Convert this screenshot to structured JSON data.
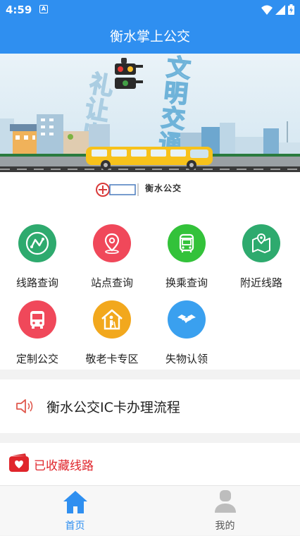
{
  "status_bar": {
    "time": "4:59",
    "notification_glyph": "A"
  },
  "app_bar": {
    "title": "衡水掌上公交"
  },
  "banner": {
    "slogan_left": "礼让出行",
    "slogan_right": "文明交通"
  },
  "logo": {
    "text": "衡水公交"
  },
  "menu": {
    "items": [
      {
        "label": "线路查询",
        "color": "#2eaa6e",
        "icon": "route-icon"
      },
      {
        "label": "站点查询",
        "color": "#f0485a",
        "icon": "location-pin-icon"
      },
      {
        "label": "换乘查询",
        "color": "#33c23a",
        "icon": "bus-front-icon"
      },
      {
        "label": "附近线路",
        "color": "#2eaa6e",
        "icon": "map-pin-icon"
      },
      {
        "label": "定制公交",
        "color": "#f0485a",
        "icon": "bus-icon"
      },
      {
        "label": "敬老卡专区",
        "color": "#f2a81d",
        "icon": "elderly-home-icon"
      },
      {
        "label": "失物认领",
        "color": "#3aa0ef",
        "icon": "handshake-icon"
      }
    ]
  },
  "notice": {
    "text": "衡水公交IC卡办理流程"
  },
  "favorites": {
    "label": "已收藏线路"
  },
  "tabs": [
    {
      "label": "首页",
      "active": true,
      "icon": "home-icon"
    },
    {
      "label": "我的",
      "active": false,
      "icon": "profile-icon"
    }
  ],
  "colors": {
    "primary": "#2f8ff0",
    "accent_red": "#e0252b",
    "tab_active": "#2f8ff0",
    "tab_inactive": "#555555"
  }
}
